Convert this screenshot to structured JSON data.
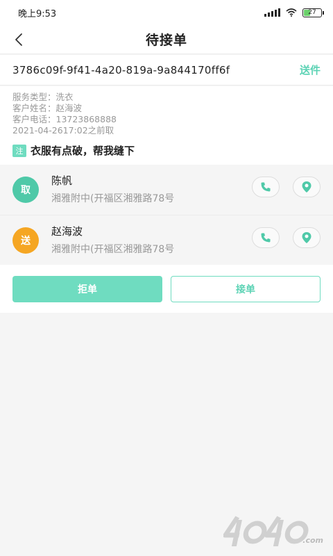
{
  "status_bar": {
    "time": "晚上9:53",
    "battery": "27"
  },
  "header": {
    "title": "待接单"
  },
  "order": {
    "id": "3786c09f-9f41-4a20-819a-9a844170ff6f",
    "send_label": "送件"
  },
  "info": {
    "lines": [
      "服务类型：洗衣",
      "客户姓名：赵海波",
      "客户电话：13723868888",
      "2021-04-2617:02之前取"
    ],
    "note_badge": "注",
    "note_text": "衣服有点破，帮我缝下"
  },
  "contacts": [
    {
      "tag": "取",
      "name": "陈帆",
      "address": "湘雅附中(开福区湘雅路78号",
      "tag_color": "#4fc9a8"
    },
    {
      "tag": "送",
      "name": "赵海波",
      "address": "湘雅附中(开福区湘雅路78号",
      "tag_color": "#f5a623"
    }
  ],
  "actions": {
    "reject_label": "拒单",
    "accept_label": "接单"
  },
  "colors": {
    "accent": "#5dd3b5",
    "accent_light": "#6fdcc0",
    "orange": "#f5a623"
  },
  "watermark": {
    "logo": "4040",
    "domain": ".com"
  }
}
